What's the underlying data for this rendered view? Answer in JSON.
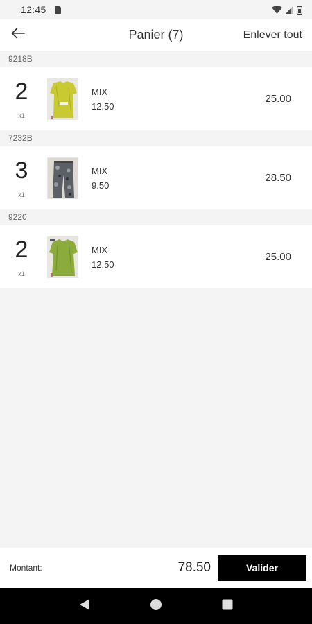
{
  "status_bar": {
    "time": "12:45",
    "icons": [
      "sim-card-icon",
      "wifi-icon",
      "signal-icon",
      "battery-icon"
    ]
  },
  "app_bar": {
    "back_icon": "arrow-left-icon",
    "title": "Panier (7)",
    "clear_all_label": "Enlever tout"
  },
  "cart": {
    "groups": [
      {
        "ref": "9218B",
        "quantity": "2",
        "unit": "x1",
        "name": "MIX",
        "unit_price": "12.50",
        "total": "25.00",
        "image": "yellow-dress-photo"
      },
      {
        "ref": "7232B",
        "quantity": "3",
        "unit": "x1",
        "name": "MIX",
        "unit_price": "9.50",
        "total": "28.50",
        "image": "camouflage-trousers-photo"
      },
      {
        "ref": "9220",
        "quantity": "2",
        "unit": "x1",
        "name": "MIX",
        "unit_price": "12.50",
        "total": "25.00",
        "image": "green-dress-photo"
      }
    ]
  },
  "footer": {
    "amount_label": "Montant:",
    "amount_value": "78.50",
    "validate_label": "Valider"
  },
  "nav_bar": {
    "icons": [
      "back-triangle-icon",
      "home-circle-icon",
      "recents-square-icon"
    ]
  },
  "colors": {
    "background": "#f4f4f4",
    "surface": "#ffffff",
    "primary_button": "#000000",
    "text": "#222222"
  }
}
